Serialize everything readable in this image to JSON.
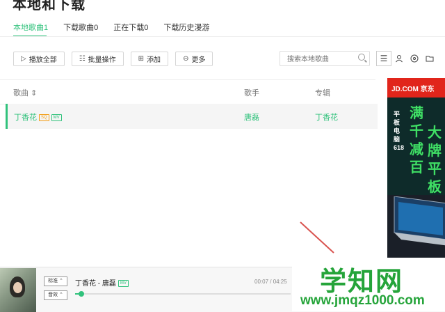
{
  "page_title": "本地和下载",
  "tabs": [
    {
      "label": "本地歌曲1",
      "active": true
    },
    {
      "label": "下载歌曲0",
      "active": false
    },
    {
      "label": "正在下载0",
      "active": false
    },
    {
      "label": "下载历史漫游",
      "active": false
    }
  ],
  "toolbar": {
    "play_all": "播放全部",
    "batch": "批量操作",
    "add": "添加",
    "more": "更多"
  },
  "search": {
    "placeholder": "搜索本地歌曲"
  },
  "table": {
    "headers": {
      "song": "歌曲",
      "artist": "歌手",
      "album": "专辑"
    },
    "rows": [
      {
        "song": "丁香花",
        "badges": [
          "SQ",
          "MV"
        ],
        "artist": "唐磊",
        "album": "丁香花"
      }
    ]
  },
  "ad": {
    "brand": "JD.COM 京东",
    "vertical_text": "平板电脑618",
    "slogan1": "满千减百",
    "slogan2": "大牌平板"
  },
  "player": {
    "quality": "标准",
    "effect": "音效",
    "track": "丁香花 - 唐磊",
    "mv_badge": "MV",
    "time": "00:07 / 04:25",
    "progress": 0.03
  },
  "watermark": {
    "text": "学知网",
    "url": "www.jmqz1000.com"
  },
  "colors": {
    "accent": "#31c27c",
    "sq_badge": "#f39c12",
    "ad_red": "#e1251b",
    "watermark": "#25a43a"
  }
}
